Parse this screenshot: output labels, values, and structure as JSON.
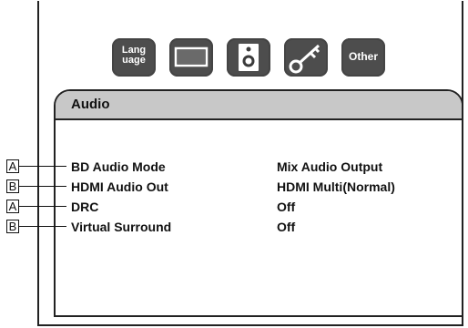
{
  "tabs": [
    {
      "name": "language",
      "label_line1": "Lang",
      "label_line2": "uage"
    },
    {
      "name": "display",
      "icon": "monitor-icon"
    },
    {
      "name": "audio",
      "icon": "speaker-icon"
    },
    {
      "name": "parental",
      "icon": "key-icon"
    },
    {
      "name": "other",
      "label": "Other"
    }
  ],
  "panel": {
    "title": "Audio",
    "settings": [
      {
        "marker": "A",
        "label": "BD Audio Mode",
        "value": "Mix Audio Output"
      },
      {
        "marker": "B",
        "label": "HDMI Audio Out",
        "value": "HDMI Multi(Normal)"
      },
      {
        "marker": "A",
        "label": "DRC",
        "value": "Off"
      },
      {
        "marker": "B",
        "label": "Virtual Surround",
        "value": "Off"
      }
    ]
  },
  "colors": {
    "icon_fill": "#4d4d4d",
    "header_fill": "#c8c8c8"
  }
}
